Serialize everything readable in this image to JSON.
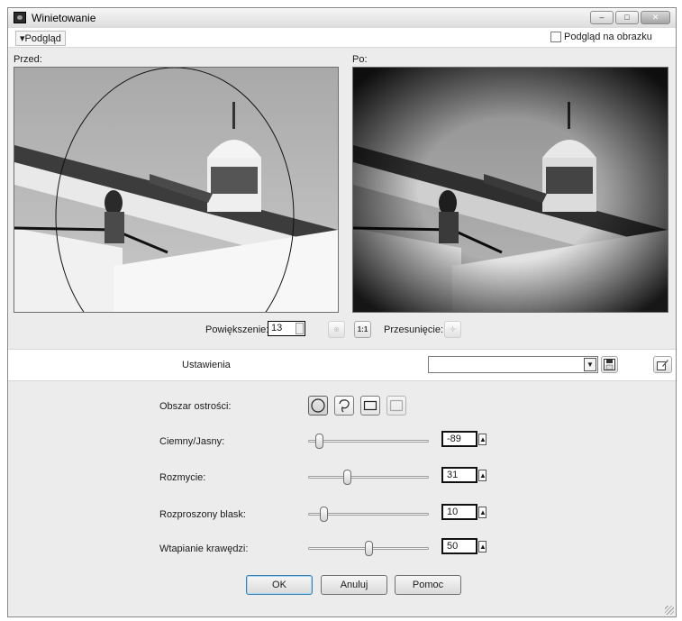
{
  "window": {
    "title": "Winietowanie",
    "controls": {
      "minimize": "–",
      "maximize": "□",
      "close": "✕"
    }
  },
  "preview": {
    "toggle_label": "▾Podgląd",
    "on_image_label": "Podgląd na obrazku",
    "before_label": "Przed:",
    "after_label": "Po:"
  },
  "zoom": {
    "label": "Powiększenie:",
    "value": "13",
    "pan_label": "Przesunięcie:"
  },
  "settings": {
    "label": "Ustawienia",
    "preset_value": ""
  },
  "controls": {
    "focus_area_label": "Obszar ostrości:",
    "focus_shapes": [
      "ellipse-icon",
      "freehand-icon",
      "rectangle-icon",
      "rounded-rectangle-icon"
    ],
    "sliders": [
      {
        "label": "Ciemny/Jasny:",
        "value": "-89",
        "fraction": 0.06
      },
      {
        "label": "Rozmycie:",
        "value": "31",
        "fraction": 0.31
      },
      {
        "label": "Rozproszony blask:",
        "value": "10",
        "fraction": 0.1
      },
      {
        "label": "Wtapianie krawędzi:",
        "value": "50",
        "fraction": 0.5
      }
    ]
  },
  "buttons": {
    "ok": "OK",
    "cancel": "Anuluj",
    "help": "Pomoc"
  }
}
